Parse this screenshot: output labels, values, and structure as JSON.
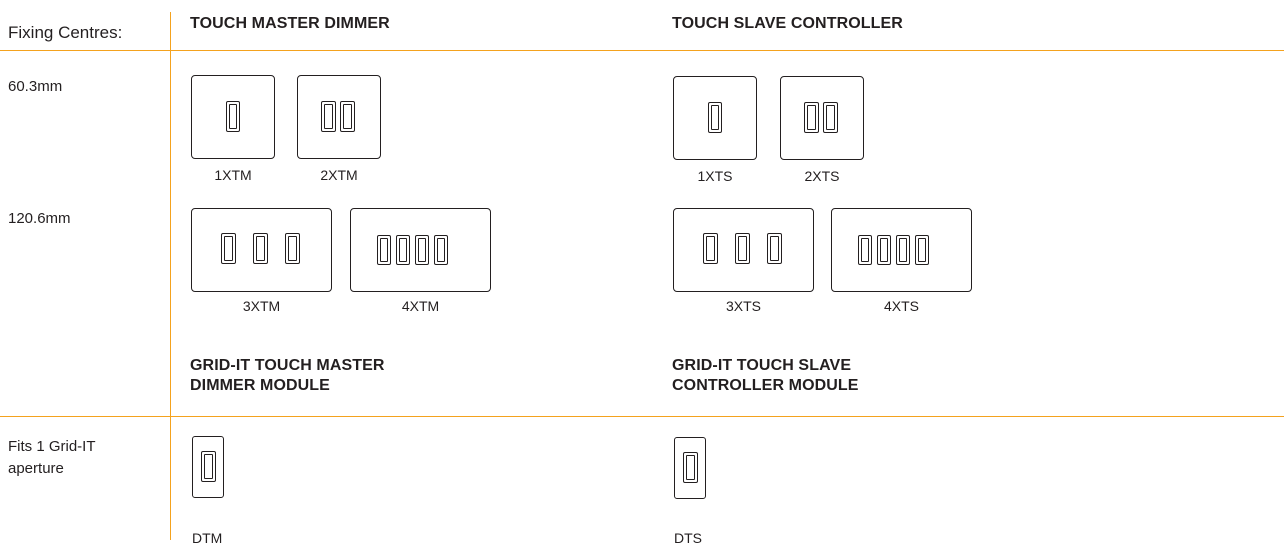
{
  "rows": {
    "header_label": "Fixing Centres:",
    "row1_label": "60.3mm",
    "row2_label": "120.6mm",
    "row3_label": "Fits 1 Grid-IT\naperture"
  },
  "sections": {
    "master_title": "TOUCH MASTER DIMMER",
    "slave_title": "TOUCH SLAVE CONTROLLER",
    "gridit_master_title": "GRID-IT TOUCH MASTER\nDIMMER MODULE",
    "gridit_slave_title": "GRID-IT TOUCH SLAVE\nCONTROLLER MODULE"
  },
  "products": {
    "m1": "1XTM",
    "m2": "2XTM",
    "m3": "3XTM",
    "m4": "4XTM",
    "s1": "1XTS",
    "s2": "2XTS",
    "s3": "3XTS",
    "s4": "4XTS",
    "dtm": "DTM",
    "dts": "DTS"
  },
  "colors": {
    "rule": "#f4a21e",
    "ink": "#231f20"
  }
}
